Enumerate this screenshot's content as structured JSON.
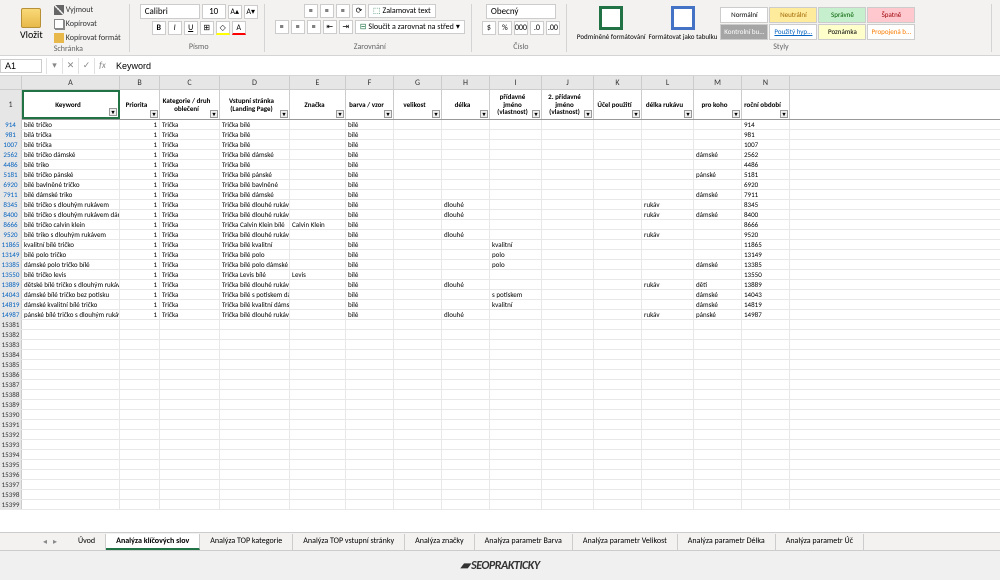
{
  "ribbon": {
    "clipboard": {
      "label": "Schránka",
      "paste": "Vložit",
      "cut": "Vyjmout",
      "copy": "Kopírovat",
      "format_painter": "Kopírovat formát"
    },
    "font": {
      "label": "Písmo",
      "family": "Calibri",
      "size": "10",
      "increase": "A",
      "decrease": "A",
      "bold": "B",
      "italic": "I",
      "underline": "U"
    },
    "alignment": {
      "label": "Zarovnání",
      "wrap": "Zalamovat text",
      "merge": "Sloučit a zarovnat na střed"
    },
    "number": {
      "label": "Číslo",
      "format": "Obecný"
    },
    "cond": {
      "conditional": "Podmíněné formátování",
      "as_table": "Formátovat jako tabulku"
    },
    "styles": {
      "label": "Styly",
      "normal": "Normální",
      "neutral": "Neutrální",
      "good": "Správně",
      "bad": "Špatně",
      "check": "Kontrolní bu...",
      "link": "Použitý hyp...",
      "note": "Poznámka",
      "linked": "Propojená b..."
    }
  },
  "formula_bar": {
    "cell_ref": "A1",
    "value": "Keyword"
  },
  "col_letters": [
    "A",
    "B",
    "C",
    "D",
    "E",
    "F",
    "G",
    "H",
    "I",
    "J",
    "K",
    "L",
    "M",
    "N"
  ],
  "headers": [
    "Keyword",
    "Priorita",
    "Kategorie / druh oblečení",
    "Vstupní stránka (Landing Page)",
    "Značka",
    "barva / vzor",
    "velikost",
    "délka",
    "přídavné jméno (vlastnost)",
    "2. přídavné jméno (vlastnost)",
    "Účel použití",
    "délka rukávu",
    "pro koho",
    "roční období"
  ],
  "header_row_num": "1",
  "rows": [
    {
      "n": "914",
      "a": "bílé tričko",
      "b": "1",
      "c": "Trička",
      "d": "Trička bílé",
      "f": "bílé"
    },
    {
      "n": "981",
      "a": "bílá trička",
      "b": "1",
      "c": "Trička",
      "d": "Trička bílé",
      "f": "bílé"
    },
    {
      "n": "1007",
      "a": "bílé trička",
      "b": "1",
      "c": "Trička",
      "d": "Trička bílé",
      "f": "bílé"
    },
    {
      "n": "2562",
      "a": "bílé tričko dámské",
      "b": "1",
      "c": "Trička",
      "d": "Trička bílé dámské",
      "f": "bílé",
      "m": "dámské"
    },
    {
      "n": "4486",
      "a": "bílé triko",
      "b": "1",
      "c": "Trička",
      "d": "Trička bílé",
      "f": "bílé"
    },
    {
      "n": "5181",
      "a": "bílé tričko pánské",
      "b": "1",
      "c": "Trička",
      "d": "Trička bílé pánské",
      "f": "bílé",
      "m": "pánské"
    },
    {
      "n": "6920",
      "a": "bílé bavlněné tričko",
      "b": "1",
      "c": "Trička",
      "d": "Trička bílé bavlněné",
      "f": "bílé"
    },
    {
      "n": "7911",
      "a": "bílé dámské triko",
      "b": "1",
      "c": "Trička",
      "d": "Trička bílé dámské",
      "f": "bílé",
      "m": "dámské"
    },
    {
      "n": "8345",
      "a": "bílé tričko s dlouhým rukávem",
      "b": "1",
      "c": "Trička",
      "d": "Trička bílé dlouhé rukáv",
      "f": "bílé",
      "h": "dlouhé",
      "l": "rukáv"
    },
    {
      "n": "8400",
      "a": "bílé tričko s dlouhým rukávem dám",
      "b": "1",
      "c": "Trička",
      "d": "Trička bílé dlouhé rukáv dámské",
      "f": "bílé",
      "h": "dlouhé",
      "l": "rukáv",
      "m": "dámské"
    },
    {
      "n": "8666",
      "a": "bílé tričko calvin klein",
      "b": "1",
      "c": "Trička",
      "d": "Trička Calvin Klein bílé",
      "e": "Calvin Klein",
      "f": "bílé"
    },
    {
      "n": "9520",
      "a": "bílé triko s dlouhým rukávem",
      "b": "1",
      "c": "Trička",
      "d": "Trička bílé dlouhé rukáv",
      "f": "bílé",
      "h": "dlouhé",
      "l": "rukáv"
    },
    {
      "n": "11865",
      "a": "kvalitní bílé tričko",
      "b": "1",
      "c": "Trička",
      "d": "Trička bílé kvalitní",
      "f": "bílé",
      "i": "kvalitní"
    },
    {
      "n": "13149",
      "a": "bílé polo tričko",
      "b": "1",
      "c": "Trička",
      "d": "Trička bílé polo",
      "f": "bílé",
      "i": "polo"
    },
    {
      "n": "13385",
      "a": "dámské polo tričko bílé",
      "b": "1",
      "c": "Trička",
      "d": "Trička bílé polo dámské",
      "f": "bílé",
      "i": "polo",
      "m": "dámské"
    },
    {
      "n": "13550",
      "a": "bílé tričko levis",
      "b": "1",
      "c": "Trička",
      "d": "Trička Levis bílé",
      "e": "Levis",
      "f": "bílé"
    },
    {
      "n": "13889",
      "a": "dětské bílé tričko s dlouhým rukáve",
      "b": "1",
      "c": "Trička",
      "d": "Trička bílé dlouhé rukáv děti",
      "f": "bílé",
      "h": "dlouhé",
      "l": "rukáv",
      "m": "děti"
    },
    {
      "n": "14043",
      "a": "dámské bílé tričko bez potisku",
      "b": "1",
      "c": "Trička",
      "d": "Trička bílé s potiskem dámské",
      "f": "bílé",
      "i": "s potiskem",
      "m": "dámské"
    },
    {
      "n": "14819",
      "a": "dámské kvalitní bílé tričko",
      "b": "1",
      "c": "Trička",
      "d": "Trička bílé kvalitní dámské",
      "f": "bílé",
      "i": "kvalitní",
      "m": "dámské"
    },
    {
      "n": "14987",
      "a": "pánské bílé tričko s dlouhým rukáv",
      "b": "1",
      "c": "Trička",
      "d": "Trička bílé dlouhé rukáv pánské",
      "f": "bílé",
      "h": "dlouhé",
      "l": "rukáv",
      "m": "pánské"
    }
  ],
  "empty_rows": [
    "15381",
    "15382",
    "15383",
    "15384",
    "15385",
    "15386",
    "15387",
    "15388",
    "15389",
    "15390",
    "15391",
    "15392",
    "15393",
    "15394",
    "15395",
    "15396",
    "15397",
    "15398",
    "15399"
  ],
  "tabs": {
    "items": [
      "Úvod",
      "Analýza klíčových slov",
      "Analýza TOP kategorie",
      "Analýza TOP vstupní stránky",
      "Analýza značky",
      "Analýza parametr Barva",
      "Analýza parametr Velikost",
      "Analýza parametr Délka",
      "Analýza parametr Úč"
    ],
    "active_index": 1
  },
  "footer": {
    "logo": "SEOPRAKTICKY"
  }
}
